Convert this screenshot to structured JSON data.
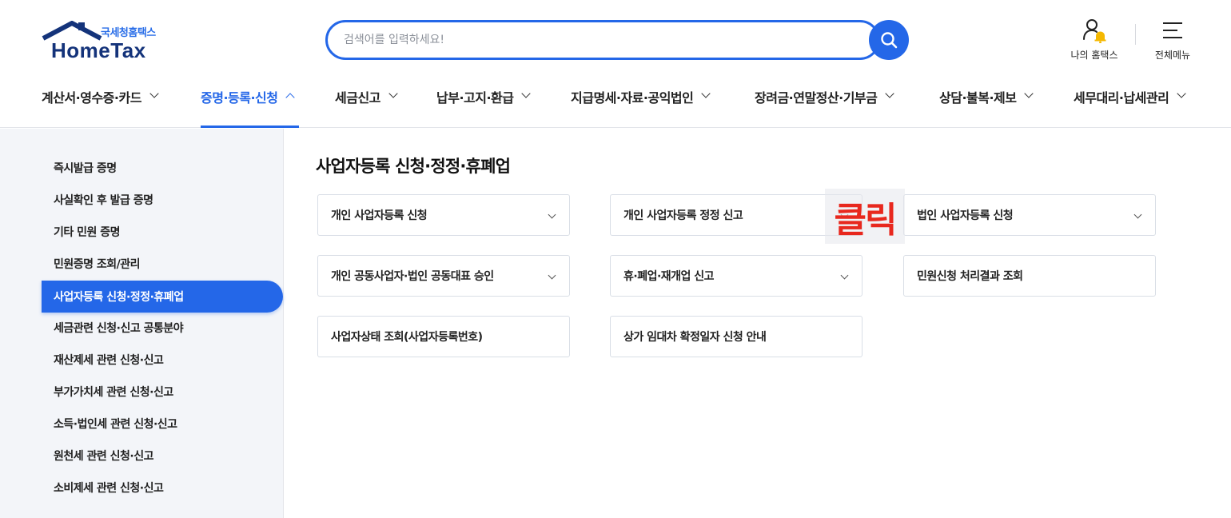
{
  "header": {
    "logo_sub": "국세청홈택스",
    "logo_main": "HomeTax",
    "search_placeholder": "검색어를 입력하세요!",
    "my_hometax_label": "나의 홈택스",
    "all_menu_label": "전체메뉴",
    "icons": {
      "search": "search-icon",
      "user": "user-icon",
      "bell": "bell-icon",
      "menu": "hamburger-icon"
    },
    "colors": {
      "accent": "#2467e8",
      "logo_dark": "#14337a",
      "bell": "#f5b800"
    }
  },
  "gnb": {
    "items": [
      {
        "label": "계산서·영수증·카드",
        "active": false
      },
      {
        "label": "증명·등록·신청",
        "active": true
      },
      {
        "label": "세금신고",
        "active": false
      },
      {
        "label": "납부·고지·환급",
        "active": false
      },
      {
        "label": "지급명세·자료·공익법인",
        "active": false
      },
      {
        "label": "장려금·연말정산·기부금",
        "active": false
      },
      {
        "label": "상담·불복·제보",
        "active": false
      },
      {
        "label": "세무대리·납세관리",
        "active": false
      }
    ]
  },
  "sidebar": {
    "items": [
      {
        "label": "즉시발급 증명",
        "active": false
      },
      {
        "label": "사실확인 후 발급 증명",
        "active": false
      },
      {
        "label": "기타 민원 증명",
        "active": false
      },
      {
        "label": "민원증명 조회/관리",
        "active": false
      },
      {
        "label": "사업자등록 신청·정정·휴폐업",
        "active": true
      },
      {
        "label": "세금관련 신청·신고 공통분야",
        "active": false
      },
      {
        "label": "재산제세 관련 신청·신고",
        "active": false
      },
      {
        "label": "부가가치세 관련 신청·신고",
        "active": false
      },
      {
        "label": "소득·법인세 관련 신청·신고",
        "active": false
      },
      {
        "label": "원천세 관련 신청·신고",
        "active": false
      },
      {
        "label": "소비제세 관련 신청·신고",
        "active": false
      }
    ]
  },
  "content": {
    "title": "사업자등록 신청·정정·휴폐업",
    "cards": [
      {
        "label": "개인 사업자등록 신청",
        "expandable": true
      },
      {
        "label": "개인 사업자등록 정정 신고",
        "expandable": true
      },
      {
        "label": "법인 사업자등록 신청",
        "expandable": true
      },
      {
        "label": "개인 공동사업자·법인 공동대표 승인",
        "expandable": true
      },
      {
        "label": "휴·폐업·재개업 신고",
        "expandable": true
      },
      {
        "label": "민원신청 처리결과 조회",
        "expandable": false
      },
      {
        "label": "사업자상태 조회(사업자등록번호)",
        "expandable": false
      },
      {
        "label": "상가 임대차 확정일자 신청 안내",
        "expandable": false
      }
    ],
    "annotation": "클릭",
    "annotation_color": "#e8281e"
  }
}
